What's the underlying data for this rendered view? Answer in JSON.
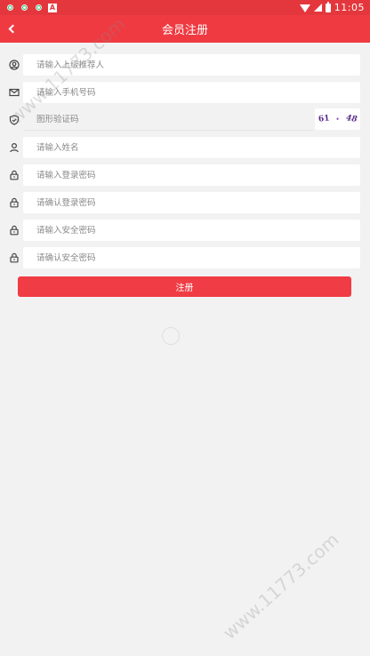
{
  "status_bar": {
    "time": "11:05",
    "icons": [
      "app-green-icon",
      "app-green-icon",
      "app-green-icon",
      "app-a-icon",
      "wifi-icon",
      "signal-icon",
      "battery-icon"
    ]
  },
  "nav": {
    "title": "会员注册",
    "back_icon": "chevron-left-icon"
  },
  "form": {
    "fields": [
      {
        "icon": "user-circle-icon",
        "placeholder": "请输入上级推荐人"
      },
      {
        "icon": "envelope-icon",
        "placeholder": "请输入手机号码"
      },
      {
        "icon": "shield-check-icon",
        "placeholder": "图形验证码"
      },
      {
        "icon": "person-icon",
        "placeholder": "请输入姓名"
      },
      {
        "icon": "lock-icon",
        "placeholder": "请输入登录密码"
      },
      {
        "icon": "lock-icon",
        "placeholder": "请确认登录密码"
      },
      {
        "icon": "lock-icon",
        "placeholder": "请输入安全密码"
      },
      {
        "icon": "lock-icon",
        "placeholder": "请确认安全密码"
      }
    ],
    "captcha": {
      "part1": "61",
      "part2": "•",
      "part3": "48"
    },
    "submit_label": "注册"
  },
  "watermark": {
    "text": "www.11773.com"
  },
  "colors": {
    "header": "#ef3a42",
    "status_bar": "#e4373d",
    "button": "#f03c44",
    "background": "#f2f2f2"
  }
}
